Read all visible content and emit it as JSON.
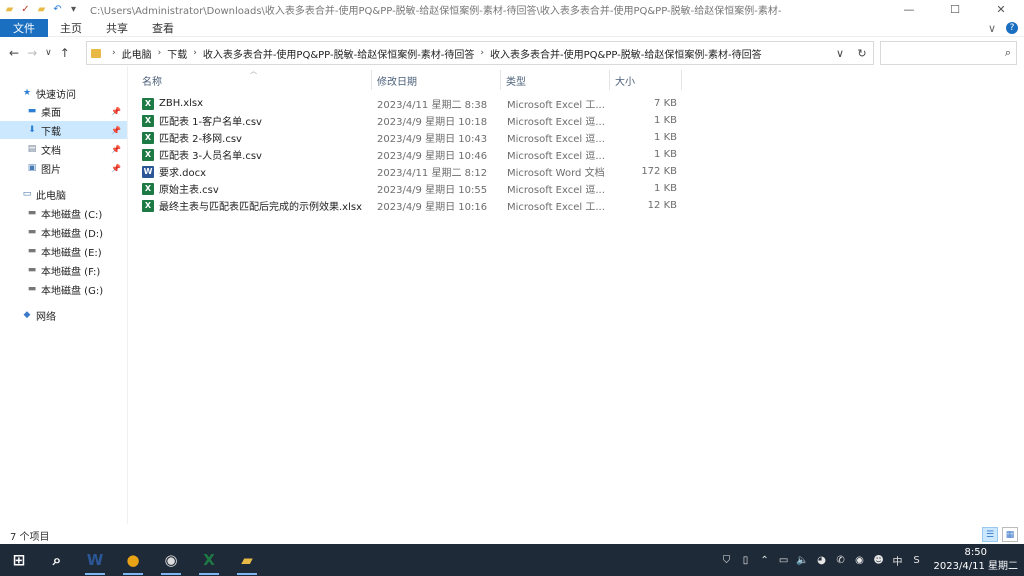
{
  "window": {
    "title": "C:\\Users\\Administrator\\Downloads\\收入表多表合并-使用PQ&PP-脱敏-给赵保恒案例-素材-待回答\\收入表多表合并-使用PQ&PP-脱敏-给赵保恒案例-素材-",
    "controls": {
      "minimize": "—",
      "maximize": "☐",
      "close": "✕"
    }
  },
  "ribbon": {
    "tabs": [
      "文件",
      "主页",
      "共享",
      "查看"
    ],
    "expand": "∨",
    "help": "?"
  },
  "nav": {
    "back": "←",
    "forward": "→",
    "recent": "∨",
    "up": "↑",
    "breadcrumb": [
      "此电脑",
      "下载",
      "收入表多表合并-使用PQ&PP-脱敏-给赵保恒案例-素材-待回答",
      "收入表多表合并-使用PQ&PP-脱敏-给赵保恒案例-素材-待回答"
    ],
    "crumb_sep": "›",
    "dropdown": "∨",
    "refresh": "↻",
    "search_icon": "⌕",
    "search_placeholder": ""
  },
  "sidebar": {
    "items": [
      {
        "label": "快速访问",
        "icon": "star-icon",
        "glyph": "★",
        "color": "#2e7fd3",
        "level": 0,
        "pin": false,
        "selected": false
      },
      {
        "label": "桌面",
        "icon": "desktop-icon",
        "glyph": "▬",
        "color": "#2e7fd3",
        "level": 1,
        "pin": true,
        "selected": false
      },
      {
        "label": "下载",
        "icon": "download-icon",
        "glyph": "⬇",
        "color": "#2e7fd3",
        "level": 1,
        "pin": true,
        "selected": true
      },
      {
        "label": "文档",
        "icon": "document-icon",
        "glyph": "▤",
        "color": "#6b7c93",
        "level": 1,
        "pin": true,
        "selected": false
      },
      {
        "label": "图片",
        "icon": "pictures-icon",
        "glyph": "▣",
        "color": "#4a7bb7",
        "level": 1,
        "pin": true,
        "selected": false
      },
      {
        "label": "此电脑",
        "icon": "computer-icon",
        "glyph": "▭",
        "color": "#3a6ea5",
        "level": 0,
        "pin": false,
        "selected": false
      },
      {
        "label": "本地磁盘 (C:)",
        "icon": "drive-icon",
        "glyph": "▬",
        "color": "#777",
        "level": 1,
        "pin": false,
        "selected": false
      },
      {
        "label": "本地磁盘 (D:)",
        "icon": "drive-icon",
        "glyph": "▬",
        "color": "#777",
        "level": 1,
        "pin": false,
        "selected": false
      },
      {
        "label": "本地磁盘 (E:)",
        "icon": "drive-icon",
        "glyph": "▬",
        "color": "#777",
        "level": 1,
        "pin": false,
        "selected": false
      },
      {
        "label": "本地磁盘 (F:)",
        "icon": "drive-icon",
        "glyph": "▬",
        "color": "#777",
        "level": 1,
        "pin": false,
        "selected": false
      },
      {
        "label": "本地磁盘 (G:)",
        "icon": "drive-icon",
        "glyph": "▬",
        "color": "#777",
        "level": 1,
        "pin": false,
        "selected": false
      },
      {
        "label": "网络",
        "icon": "network-icon",
        "glyph": "◆",
        "color": "#3a78c9",
        "level": 0,
        "pin": false,
        "selected": false
      }
    ],
    "pin_glyph": "📌"
  },
  "columns": [
    "名称",
    "修改日期",
    "类型",
    "大小"
  ],
  "files": [
    {
      "name": "ZBH.xlsx",
      "modified": "2023/4/11 星期二 8:38",
      "type": "Microsoft Excel 工...",
      "size": "7 KB",
      "icon": "excel-icon",
      "badge": "X",
      "color": "#1d7a45"
    },
    {
      "name": "匹配表 1-客户名单.csv",
      "modified": "2023/4/9 星期日 10:18",
      "type": "Microsoft Excel 逗...",
      "size": "1 KB",
      "icon": "excel-csv-icon",
      "badge": "X",
      "color": "#1d7a45"
    },
    {
      "name": "匹配表 2-移网.csv",
      "modified": "2023/4/9 星期日 10:43",
      "type": "Microsoft Excel 逗...",
      "size": "1 KB",
      "icon": "excel-csv-icon",
      "badge": "X",
      "color": "#1d7a45"
    },
    {
      "name": "匹配表 3-人员名单.csv",
      "modified": "2023/4/9 星期日 10:46",
      "type": "Microsoft Excel 逗...",
      "size": "1 KB",
      "icon": "excel-csv-icon",
      "badge": "X",
      "color": "#1d7a45"
    },
    {
      "name": "要求.docx",
      "modified": "2023/4/11 星期二 8:12",
      "type": "Microsoft Word 文档",
      "size": "172 KB",
      "icon": "word-icon",
      "badge": "W",
      "color": "#2b5797"
    },
    {
      "name": "原始主表.csv",
      "modified": "2023/4/9 星期日 10:55",
      "type": "Microsoft Excel 逗...",
      "size": "1 KB",
      "icon": "excel-csv-icon",
      "badge": "X",
      "color": "#1d7a45"
    },
    {
      "name": "最终主表与匹配表匹配后完成的示例效果.xlsx",
      "modified": "2023/4/9 星期日 10:16",
      "type": "Microsoft Excel 工...",
      "size": "12 KB",
      "icon": "excel-icon",
      "badge": "X",
      "color": "#1d7a45"
    }
  ],
  "status": {
    "count": "7 个项目"
  },
  "view": {
    "details": "☰",
    "tiles": "▦"
  },
  "taskbar": {
    "apps": [
      {
        "name": "start-button",
        "glyph": "⊞",
        "color": "#ffffff",
        "active": false
      },
      {
        "name": "search-button",
        "glyph": "⌕",
        "color": "#ffffff",
        "active": false
      },
      {
        "name": "word-app",
        "glyph": "W",
        "color": "#2b5797",
        "active": true
      },
      {
        "name": "chrome-app",
        "glyph": "●",
        "color": "#e8a317",
        "active": true
      },
      {
        "name": "obs-app",
        "glyph": "◉",
        "color": "#dddddd",
        "active": true
      },
      {
        "name": "excel-app",
        "glyph": "X",
        "color": "#1d7a45",
        "active": true
      },
      {
        "name": "file-explorer-app",
        "glyph": "▰",
        "color": "#e8b945",
        "active": true
      }
    ],
    "tray": [
      "⛉",
      "▯",
      "⌃",
      "▭",
      "🔈",
      "◕",
      "✆",
      "◉",
      "☻",
      "中",
      "S"
    ],
    "time": "8:50",
    "date": "2023/4/11 星期二"
  }
}
